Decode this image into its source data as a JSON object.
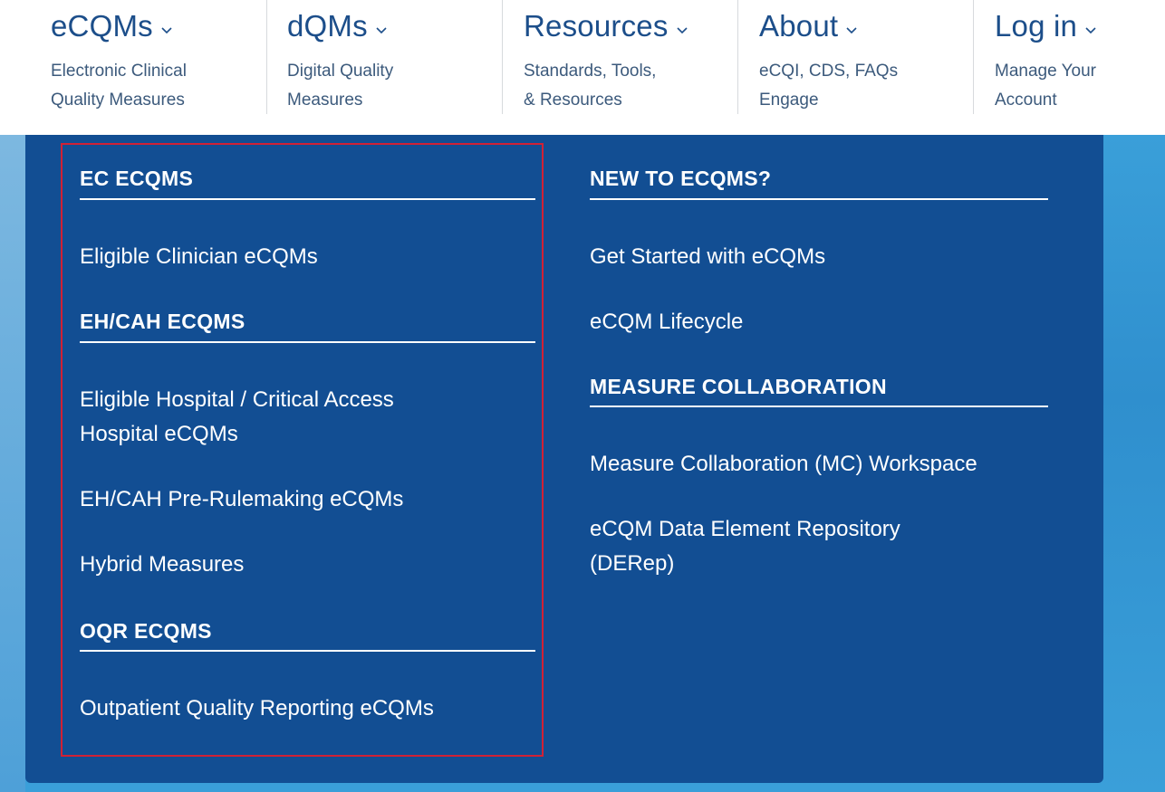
{
  "nav": {
    "items": [
      {
        "title": "eCQMs",
        "subtitle_line1": "Electronic Clinical",
        "subtitle_line2": "Quality Measures"
      },
      {
        "title": "dQMs",
        "subtitle_line1": "Digital Quality",
        "subtitle_line2": "Measures"
      },
      {
        "title": "Resources",
        "subtitle_line1": "Standards, Tools,",
        "subtitle_line2": "& Resources"
      },
      {
        "title": "About",
        "subtitle_line1": "eCQI, CDS, FAQs",
        "subtitle_line2": "Engage"
      },
      {
        "title": "Log in",
        "subtitle_line1": "Manage Your",
        "subtitle_line2": "Account"
      }
    ]
  },
  "menu": {
    "left": {
      "ec_heading": "EC ECQMS",
      "ec_links": [
        "Eligible Clinician eCQMs"
      ],
      "eh_heading": "EH/CAH ECQMS",
      "eh_link1_line1": "Eligible Hospital / Critical Access",
      "eh_link1_line2": "Hospital eCQMs",
      "eh_links": [
        "EH/CAH Pre-Rulemaking eCQMs",
        "Hybrid Measures"
      ],
      "oqr_heading": "OQR ECQMS",
      "oqr_links": [
        "Outpatient Quality Reporting eCQMs"
      ]
    },
    "right": {
      "new_heading": "NEW TO ECQMS?",
      "new_links": [
        "Get Started with eCQMs",
        "eCQM Lifecycle"
      ],
      "mc_heading": "MEASURE COLLABORATION",
      "mc_link1": "Measure Collaboration (MC) Workspace",
      "mc_link2_line1": "eCQM Data Element Repository",
      "mc_link2_line2": "(DERep)"
    }
  },
  "colors": {
    "panel": "#124e93",
    "nav_text": "#1c4e8a",
    "highlight": "#d12135",
    "sky": "#3a9fd9"
  }
}
